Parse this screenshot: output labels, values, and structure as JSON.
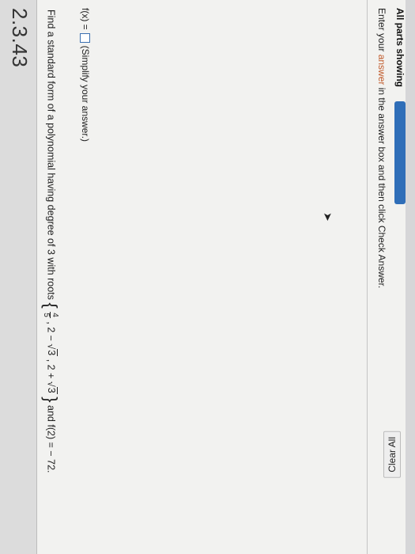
{
  "title": "2.3.43",
  "question": {
    "prefix": "Find a standard form of a polynomial having degree of 3 with roots",
    "frac_num": "4",
    "frac_den": "5",
    "root2_prefix": ", 2 − ",
    "root2_rad": "3",
    "root3_prefix": ", 2 + ",
    "root3_rad": "3",
    "suffix": "and f(2) = − 72."
  },
  "answer": {
    "label": "f(x) =",
    "hint": "(Simplify your answer.)"
  },
  "instruction": {
    "part1": "Enter your ",
    "highlight": "answer",
    "part2": " in the answer box and then click Check Answer."
  },
  "footer": {
    "parts_label": "All parts showing",
    "progress": 1.0,
    "clear_label": "Clear All"
  },
  "colors": {
    "accent": "#2f6eb8",
    "answer_box_border": "#3a6fb0"
  }
}
